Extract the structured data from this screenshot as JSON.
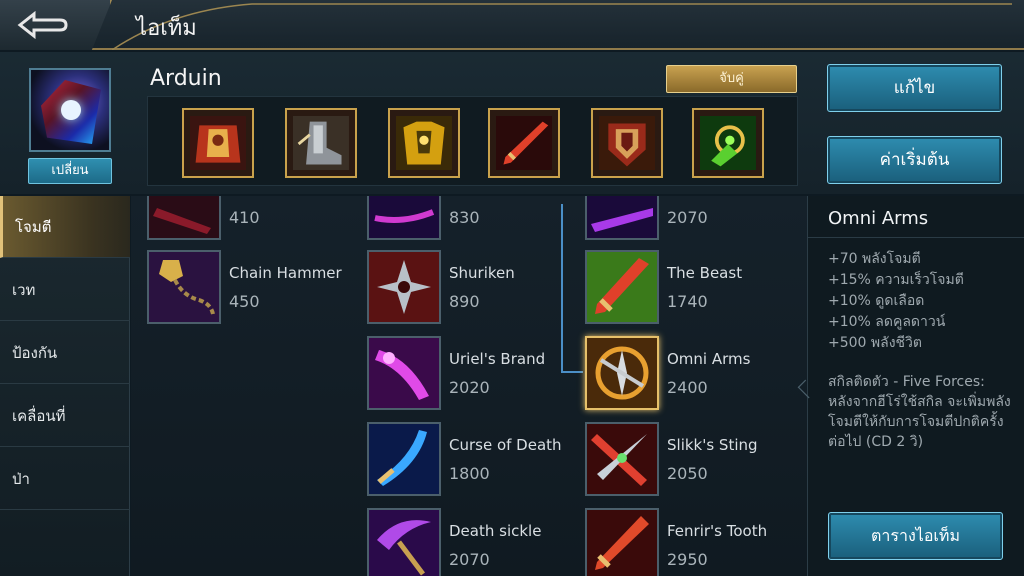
{
  "topbar": {
    "title": "ไอเท็ม",
    "back_icon": "back-arrow-icon"
  },
  "hero": {
    "name": "Arduin",
    "change_label": "เปลี่ยน",
    "pair_label": "จับคู่"
  },
  "build_slots": [
    {
      "icon": "red-cape-armor-icon"
    },
    {
      "icon": "boots-icon"
    },
    {
      "icon": "gold-armor-icon"
    },
    {
      "icon": "red-blade-icon"
    },
    {
      "icon": "crimson-shield-icon"
    },
    {
      "icon": "green-amulet-icon"
    }
  ],
  "side_buttons": {
    "edit_label": "แก้ไข",
    "reset_label": "ค่าเริ่มต้น"
  },
  "categories": [
    {
      "label": "โจมตี",
      "active": true
    },
    {
      "label": "เวท",
      "active": false
    },
    {
      "label": "ป้องกัน",
      "active": false
    },
    {
      "label": "เคลื่อนที่",
      "active": false
    },
    {
      "label": "ป่า",
      "active": false
    }
  ],
  "items": {
    "col1": [
      {
        "name": "",
        "price": "410",
        "icon": "dark-blade-icon"
      },
      {
        "name": "Chain Hammer",
        "price": "450",
        "icon": "chain-hammer-icon"
      }
    ],
    "col2": [
      {
        "name": "",
        "price": "830",
        "icon": "purple-staff-icon"
      },
      {
        "name": "Shuriken",
        "price": "890",
        "icon": "shuriken-icon"
      },
      {
        "name": "Uriel's Brand",
        "price": "2020",
        "icon": "uriels-brand-icon"
      },
      {
        "name": "Curse of Death",
        "price": "1800",
        "icon": "curse-of-death-icon"
      },
      {
        "name": "Death sickle",
        "price": "2070",
        "icon": "death-sickle-icon"
      }
    ],
    "col3": [
      {
        "name": "",
        "price": "2070",
        "icon": "purple-blade-icon"
      },
      {
        "name": "The Beast",
        "price": "1740",
        "icon": "the-beast-icon"
      },
      {
        "name": "Omni Arms",
        "price": "2400",
        "icon": "omni-arms-icon",
        "selected": true
      },
      {
        "name": "Slikk's Sting",
        "price": "2050",
        "icon": "slikks-sting-icon"
      },
      {
        "name": "Fenrir's Tooth",
        "price": "2950",
        "icon": "fenrirs-tooth-icon"
      }
    ]
  },
  "detail": {
    "title": "Omni Arms",
    "stats": [
      "+70 พลังโจมตี",
      "+15% ความเร็วโจมตี",
      "+10% ดูดเลือด",
      "+10% ลดคูลดาวน์",
      "+500 พลังชีวิต"
    ],
    "passive": "สกิลติดตัว - Five Forces: หลังจากฮีโร่ใช้สกิล จะเพิ่มพลังโจมตีให้กับการโจมตีปกติครั้งต่อไป (CD 2 วิ)",
    "item_list_label": "ตารางไอเท็ม"
  }
}
